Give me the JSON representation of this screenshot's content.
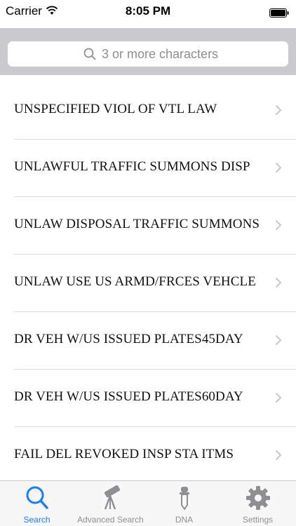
{
  "status_bar": {
    "carrier": "Carrier",
    "time": "8:05 PM"
  },
  "search": {
    "placeholder": "3 or more characters",
    "value": ""
  },
  "list": {
    "items": [
      {
        "label": "UNSPECIFIED VIOL OF VTL LAW"
      },
      {
        "label": "UNLAWFUL TRAFFIC SUMMONS DISP"
      },
      {
        "label": "UNLAW DISPOSAL TRAFFIC SUMMONS"
      },
      {
        "label": "UNLAW USE US ARMD/FRCES VEHCLE"
      },
      {
        "label": "DR VEH W/US ISSUED PLATES45DAY"
      },
      {
        "label": "DR VEH W/US ISSUED PLATES60DAY"
      },
      {
        "label": "FAIL DEL REVOKED INSP STA ITMS"
      }
    ]
  },
  "tab_bar": {
    "tabs": [
      {
        "label": "Search",
        "icon": "search-icon"
      },
      {
        "label": "Advanced Search",
        "icon": "telescope-icon"
      },
      {
        "label": "DNA",
        "icon": "dropper-icon"
      },
      {
        "label": "Settings",
        "icon": "gear-icon"
      }
    ],
    "active_index": 0
  },
  "colors": {
    "accent": "#147efb",
    "search_bar_background": "#c9c9ce",
    "inactive_tab": "#8e8e93"
  }
}
